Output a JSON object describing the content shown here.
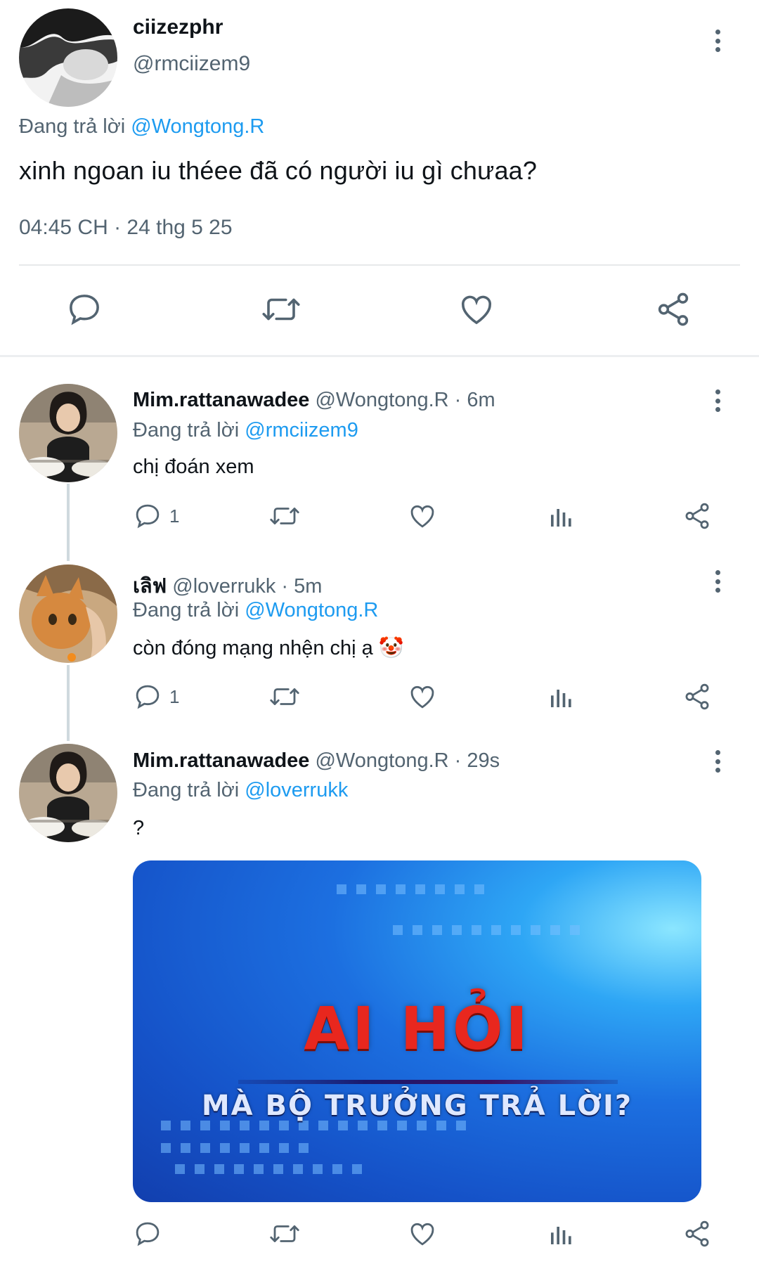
{
  "main_tweet": {
    "display_name": "ciizezphr",
    "handle": "@rmciizem9",
    "replying_prefix": "Đang trả lời",
    "replying_to": "@Wongtong.R",
    "text": "xinh ngoan iu théee đã có người iu gì chưaa?",
    "timestamp": "04:45 CH · 24 thg 5 25",
    "actions": [
      "reply-icon",
      "retweet-icon",
      "like-icon",
      "share-icon"
    ]
  },
  "replies": [
    {
      "display_name": "Mim.rattanawadee",
      "meta": "@Wongtong.R · 6m",
      "replying_prefix": "Đang trả lời",
      "replying_to": "@rmciizem9",
      "text": "chị đoán xem",
      "reply_count": "1"
    },
    {
      "display_name": "เลิฟ",
      "meta": "@loverrukk · 5m",
      "replying_prefix": "Đang trả lời",
      "replying_to": "@Wongtong.R",
      "text": "còn đóng mạng nhện chị ạ 🤡",
      "reply_count": "1"
    },
    {
      "display_name": "Mim.rattanawadee",
      "meta": "@Wongtong.R · 29s",
      "replying_prefix": "Đang trả lời",
      "replying_to": "@loverrukk",
      "text": "?",
      "reply_count": "",
      "media": {
        "line1": "AI HỎI",
        "line2": "MÀ BỘ TRƯỞNG TRẢ LỜI?"
      }
    }
  ],
  "colors": {
    "link_blue": "#1d9bf0",
    "secondary_gray": "#536471",
    "divider": "#e7e9ea"
  }
}
